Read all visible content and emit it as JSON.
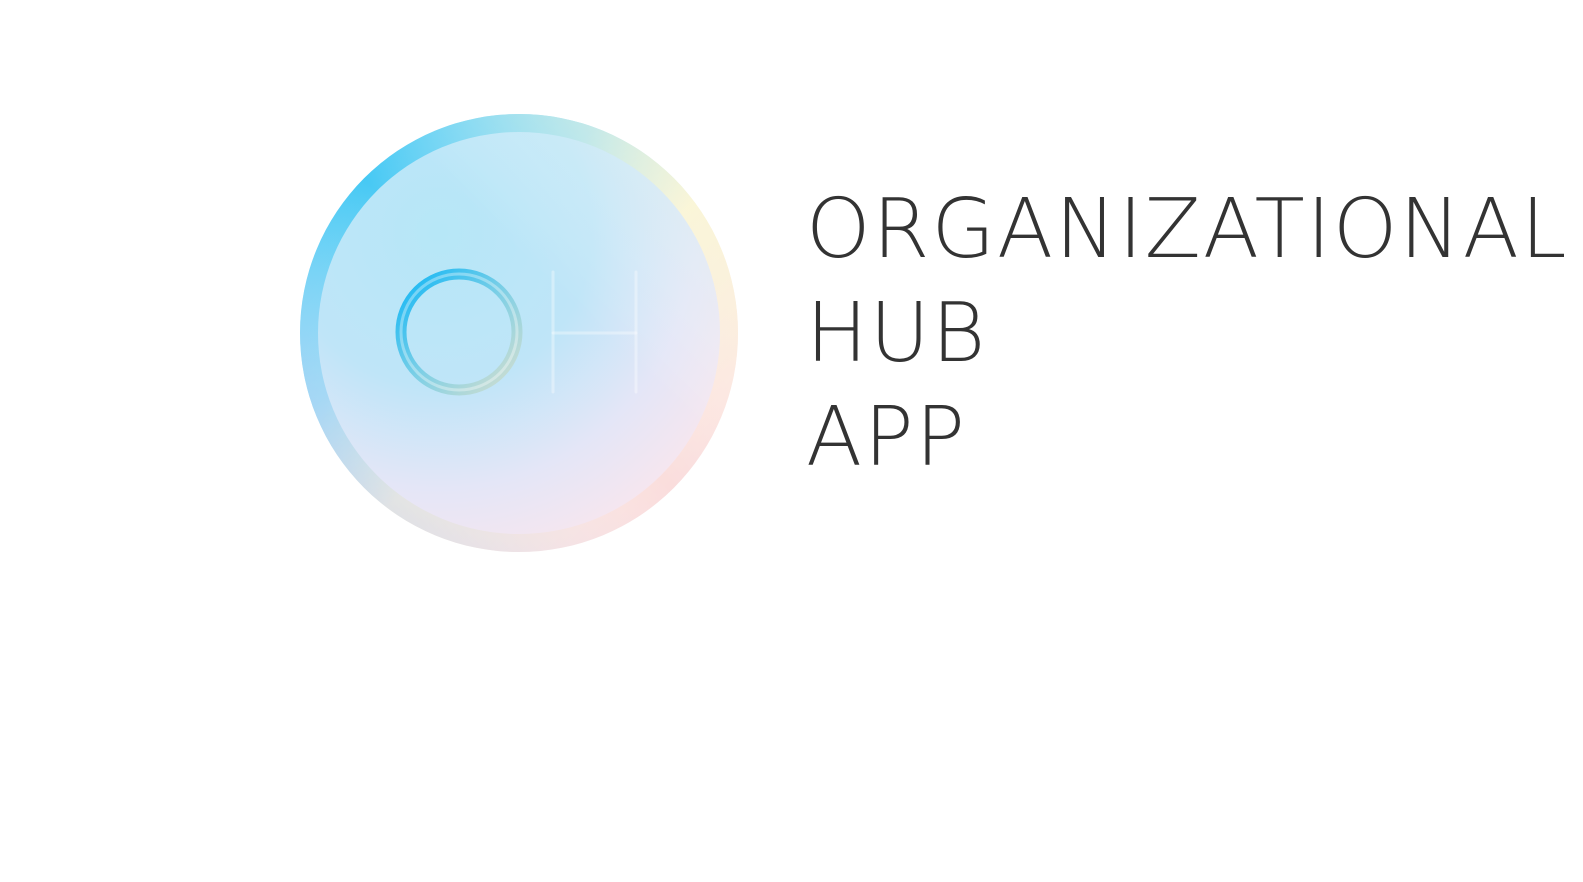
{
  "logo": {
    "monogram": "OH",
    "icon": "oh-monogram-badge",
    "colors": {
      "blue": "#1fbff5",
      "teal": "#7fdccb",
      "yellow": "#f8f2c8",
      "pink": "#f8d6e0",
      "lavender": "#c6cdf3"
    }
  },
  "wordmark": {
    "line1": "ORGANIZATIONAL",
    "line2": "HUB",
    "line3": "APP",
    "color": "#333333"
  }
}
